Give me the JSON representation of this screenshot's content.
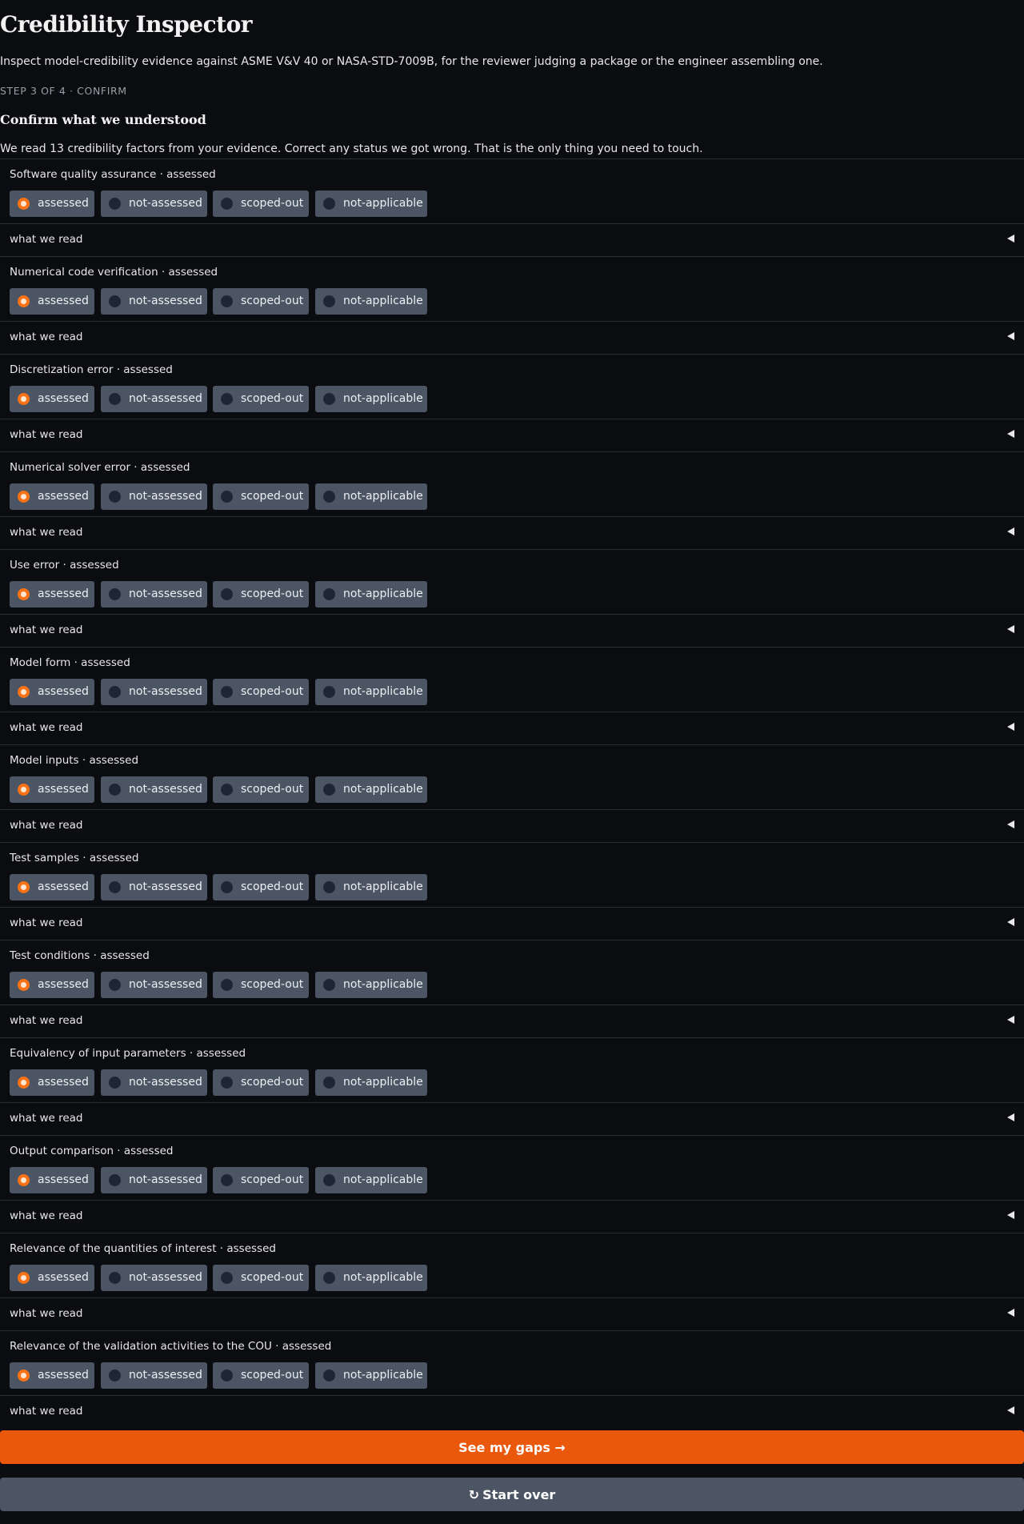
{
  "app": {
    "title": "Credibility Inspector",
    "subtitle": "Inspect model-credibility evidence against ASME V&V 40 or NASA-STD-7009B, for the reviewer judging a package or the engineer assembling one."
  },
  "step": {
    "label": "STEP 3 OF 4 · CONFIRM",
    "title": "Confirm what we understood",
    "intro": "We read 13 credibility factors from your evidence. Correct any status we got wrong. That is the only thing you need to touch."
  },
  "status_options": [
    "assessed",
    "not-assessed",
    "scoped-out",
    "not-applicable"
  ],
  "disclosure_label": "what we read",
  "factors": [
    {
      "label": "Software quality assurance · assessed",
      "selected": "assessed"
    },
    {
      "label": "Numerical code verification · assessed",
      "selected": "assessed"
    },
    {
      "label": "Discretization error · assessed",
      "selected": "assessed"
    },
    {
      "label": "Numerical solver error · assessed",
      "selected": "assessed"
    },
    {
      "label": "Use error · assessed",
      "selected": "assessed"
    },
    {
      "label": "Model form · assessed",
      "selected": "assessed"
    },
    {
      "label": "Model inputs · assessed",
      "selected": "assessed"
    },
    {
      "label": "Test samples · assessed",
      "selected": "assessed"
    },
    {
      "label": "Test conditions · assessed",
      "selected": "assessed"
    },
    {
      "label": "Equivalency of input parameters · assessed",
      "selected": "assessed"
    },
    {
      "label": "Output comparison · assessed",
      "selected": "assessed"
    },
    {
      "label": "Relevance of the quantities of interest · assessed",
      "selected": "assessed"
    },
    {
      "label": "Relevance of the validation activities to the COU · assessed",
      "selected": "assessed"
    }
  ],
  "actions": {
    "primary_label": "See my gaps →",
    "secondary_icon": "↻",
    "secondary_label": "Start over"
  },
  "colors": {
    "background": "#0b0c0f",
    "accent": "#ea580c",
    "radio_selected": "#f97316",
    "option_bg": "#4b5563"
  }
}
